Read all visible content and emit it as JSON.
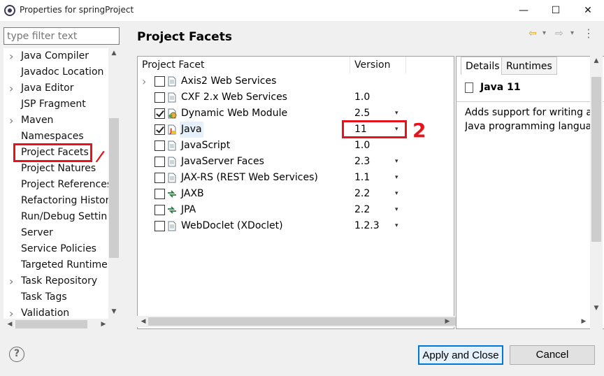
{
  "window": {
    "title": "Properties for springProject",
    "minimize": "—",
    "maximize": "☐",
    "close": "✕"
  },
  "filter": {
    "placeholder": "type filter text"
  },
  "tree": {
    "items": [
      {
        "label": "Java Compiler",
        "expandable": true
      },
      {
        "label": "Javadoc Location",
        "expandable": false
      },
      {
        "label": "Java Editor",
        "expandable": true
      },
      {
        "label": "JSP Fragment",
        "expandable": false
      },
      {
        "label": "Maven",
        "expandable": true
      },
      {
        "label": "Namespaces",
        "expandable": false
      },
      {
        "label": "Project Facets",
        "expandable": false,
        "selected": true
      },
      {
        "label": "Project Natures",
        "expandable": false
      },
      {
        "label": "Project References",
        "expandable": false
      },
      {
        "label": "Refactoring Histor",
        "expandable": false
      },
      {
        "label": "Run/Debug Settin",
        "expandable": false
      },
      {
        "label": "Server",
        "expandable": false
      },
      {
        "label": "Service Policies",
        "expandable": false
      },
      {
        "label": "Targeted Runtime",
        "expandable": false
      },
      {
        "label": "Task Repository",
        "expandable": true
      },
      {
        "label": "Task Tags",
        "expandable": false
      },
      {
        "label": "Validation",
        "expandable": true
      }
    ]
  },
  "page": {
    "title": "Project Facets"
  },
  "nav": {
    "back": "⇦",
    "drop1": "▾",
    "forward": "⇨",
    "drop2": "▾"
  },
  "facets": {
    "col_facet": "Project Facet",
    "col_version": "Version",
    "rows": [
      {
        "name": "Axis2 Web Services",
        "version": "",
        "checked": false,
        "expandable": true,
        "icon": "doc-icon",
        "dropdown": false
      },
      {
        "name": "CXF 2.x Web Services",
        "version": "1.0",
        "checked": false,
        "expandable": false,
        "icon": "doc-icon",
        "dropdown": false
      },
      {
        "name": "Dynamic Web Module",
        "version": "2.5",
        "checked": true,
        "expandable": false,
        "icon": "web-module-icon",
        "dropdown": true
      },
      {
        "name": "Java",
        "version": "11",
        "checked": true,
        "expandable": false,
        "icon": "java-icon",
        "dropdown": true,
        "selected": true
      },
      {
        "name": "JavaScript",
        "version": "1.0",
        "checked": false,
        "expandable": false,
        "icon": "doc-icon",
        "dropdown": false
      },
      {
        "name": "JavaServer Faces",
        "version": "2.3",
        "checked": false,
        "expandable": false,
        "icon": "doc-icon",
        "dropdown": true
      },
      {
        "name": "JAX-RS (REST Web Services)",
        "version": "1.1",
        "checked": false,
        "expandable": false,
        "icon": "doc-icon",
        "dropdown": true
      },
      {
        "name": "JAXB",
        "version": "2.2",
        "checked": false,
        "expandable": false,
        "icon": "swap-icon",
        "dropdown": true
      },
      {
        "name": "JPA",
        "version": "2.2",
        "checked": false,
        "expandable": false,
        "icon": "swap-icon",
        "dropdown": true
      },
      {
        "name": "WebDoclet (XDoclet)",
        "version": "1.2.3",
        "checked": false,
        "expandable": false,
        "icon": "doc-icon",
        "dropdown": true
      }
    ]
  },
  "details": {
    "tab_details": "Details",
    "tab_runtimes": "Runtimes",
    "title": "Java 11",
    "text_line1": "Adds support for writing a",
    "text_line2": "Java programming langua"
  },
  "footer": {
    "help": "?",
    "apply_close": "Apply and Close",
    "cancel": "Cancel"
  },
  "annotations": {
    "mark1": "/",
    "mark2": "2"
  },
  "colors": {
    "annotation": "#e8121c",
    "primary_border": "#0078d7"
  }
}
